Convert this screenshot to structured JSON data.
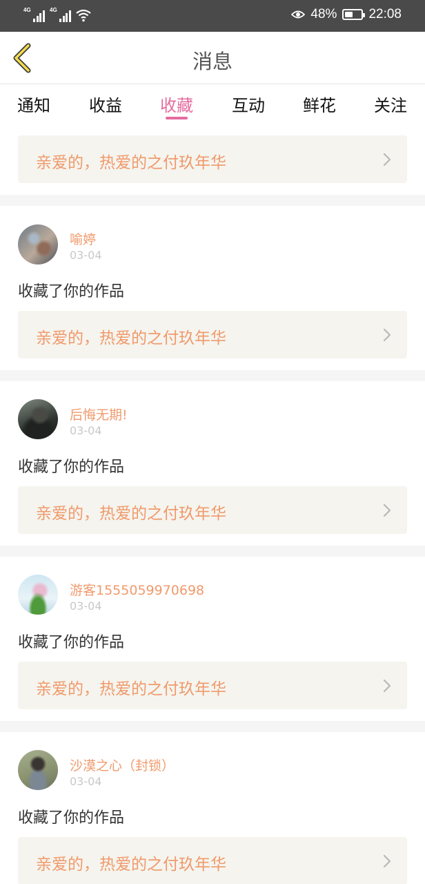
{
  "status_bar": {
    "signal1_tag": "4G",
    "signal2_tag": "4G",
    "battery": "48%",
    "battery_level": 0.48,
    "time": "22:08"
  },
  "header": {
    "title": "消息"
  },
  "tabs": [
    {
      "label": "通知",
      "active": false
    },
    {
      "label": "收益",
      "active": false
    },
    {
      "label": "收藏",
      "active": true
    },
    {
      "label": "互动",
      "active": false
    },
    {
      "label": "鲜花",
      "active": false
    },
    {
      "label": "关注",
      "active": false
    }
  ],
  "accent_color": "#e56b9f",
  "name_color": "#f09a6c",
  "top_card": {
    "work_title": "亲爱的，热爱的之付玖年华"
  },
  "items": [
    {
      "username": "喻婷",
      "date": "03-04",
      "action": "收藏了你的作品",
      "work_title": "亲爱的，热爱的之付玖年华"
    },
    {
      "username": "后悔无期!",
      "date": "03-04",
      "action": "收藏了你的作品",
      "work_title": "亲爱的，热爱的之付玖年华"
    },
    {
      "username": "游客1555059970698",
      "date": "03-04",
      "action": "收藏了你的作品",
      "work_title": "亲爱的，热爱的之付玖年华"
    },
    {
      "username": "沙漠之心（封锁）",
      "date": "03-04",
      "action": "收藏了你的作品",
      "work_title": "亲爱的，热爱的之付玖年华"
    }
  ]
}
